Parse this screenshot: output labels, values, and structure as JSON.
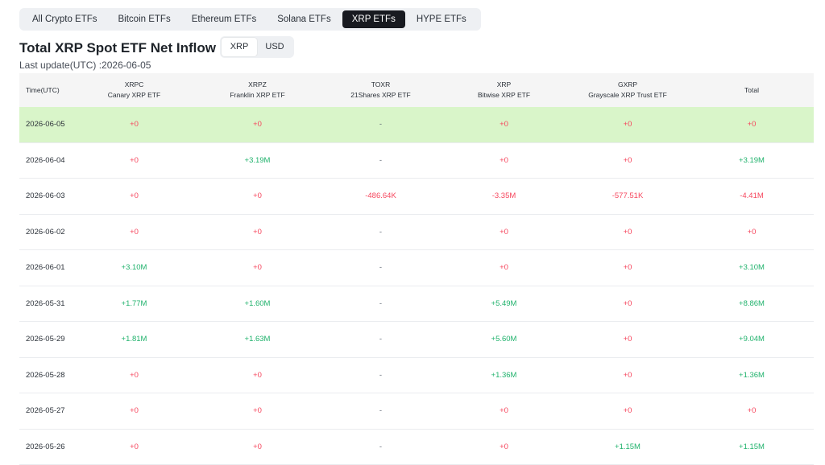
{
  "tabs": [
    "All Crypto ETFs",
    "Bitcoin ETFs",
    "Ethereum ETFs",
    "Solana ETFs",
    "XRP ETFs",
    "HYPE ETFs"
  ],
  "active_tab": "XRP ETFs",
  "title": "Total XRP Spot ETF Net Inflow (XRP)",
  "unit_toggle": {
    "xrp": "XRP",
    "usd": "USD",
    "active": "XRP"
  },
  "last_update": "Last update(UTC) :2026-06-05",
  "colors": {
    "positive": "#20b26c",
    "negative": "#f6465d",
    "highlight": "#d9f5c9",
    "active_tab": "#181a20"
  },
  "table": {
    "time_header": "Time(UTC)",
    "columns": [
      {
        "ticker": "XRPC",
        "name": "Canary XRP ETF"
      },
      {
        "ticker": "XRPZ",
        "name": "Franklin XRP ETF"
      },
      {
        "ticker": "TOXR",
        "name": "21Shares XRP ETF"
      },
      {
        "ticker": "XRP",
        "name": "Bitwise XRP ETF"
      },
      {
        "ticker": "GXRP",
        "name": "Grayscale XRP Trust ETF"
      }
    ],
    "total_header": "Total",
    "rows": [
      {
        "date": "2026-06-05",
        "cells": [
          "+0",
          "+0",
          "-",
          "+0",
          "+0",
          "+0"
        ]
      },
      {
        "date": "2026-06-04",
        "cells": [
          "+0",
          "+3.19M",
          "-",
          "+0",
          "+0",
          "+3.19M"
        ]
      },
      {
        "date": "2026-06-03",
        "cells": [
          "+0",
          "+0",
          "-486.64K",
          "-3.35M",
          "-577.51K",
          "-4.41M"
        ]
      },
      {
        "date": "2026-06-02",
        "cells": [
          "+0",
          "+0",
          "-",
          "+0",
          "+0",
          "+0"
        ]
      },
      {
        "date": "2026-06-01",
        "cells": [
          "+3.10M",
          "+0",
          "-",
          "+0",
          "+0",
          "+3.10M"
        ]
      },
      {
        "date": "2026-05-31",
        "cells": [
          "+1.77M",
          "+1.60M",
          "-",
          "+5.49M",
          "+0",
          "+8.86M"
        ]
      },
      {
        "date": "2026-05-29",
        "cells": [
          "+1.81M",
          "+1.63M",
          "-",
          "+5.60M",
          "+0",
          "+9.04M"
        ]
      },
      {
        "date": "2026-05-28",
        "cells": [
          "+0",
          "+0",
          "-",
          "+1.36M",
          "+0",
          "+1.36M"
        ]
      },
      {
        "date": "2026-05-27",
        "cells": [
          "+0",
          "+0",
          "-",
          "+0",
          "+0",
          "+0"
        ]
      },
      {
        "date": "2026-05-26",
        "cells": [
          "+0",
          "+0",
          "-",
          "+0",
          "+1.15M",
          "+1.15M"
        ]
      }
    ]
  }
}
